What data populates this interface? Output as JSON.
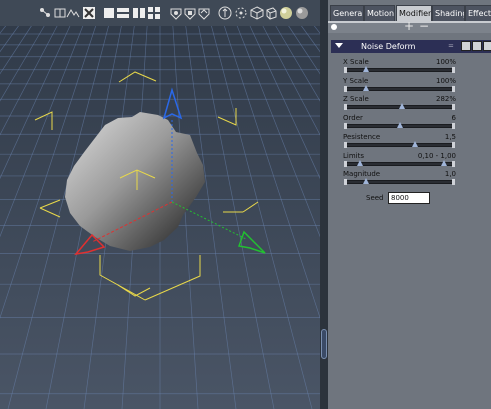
{
  "tabs": [
    "General",
    "Motion",
    "Modifier",
    "Shading",
    "Effects"
  ],
  "active_tab": "Modifier",
  "modifier_bar": {
    "add": "+",
    "remove": "−"
  },
  "deform": {
    "title": "Noise Deform",
    "extra": "="
  },
  "params": [
    {
      "label": "X Scale",
      "value": "100%",
      "level": 0.18
    },
    {
      "label": "Y Scale",
      "value": "100%",
      "level": 0.18
    },
    {
      "label": "Z Scale",
      "value": "282%",
      "level": 0.52
    },
    {
      "label": "Order",
      "value": "6",
      "level": 0.5
    },
    {
      "label": "Pesistence",
      "value": "1,5",
      "level": 0.65
    },
    {
      "label": "Limits",
      "value": "0,10 - 1,00",
      "level": 0.12,
      "level2": 0.92
    },
    {
      "label": "Magnitude",
      "value": "1,0",
      "level": 0.18
    }
  ],
  "seed": {
    "label": "Seed",
    "value": "8000"
  },
  "colors": {
    "viewport_bg": "#3b4654",
    "grid": "#6c85b0",
    "gizmo_yellow": "#e8d84a",
    "axis_x": "#e03030",
    "axis_y": "#2a68e8",
    "axis_z": "#22c030",
    "panel_bg": "#6f757e",
    "header_bg": "#2c2f55"
  }
}
